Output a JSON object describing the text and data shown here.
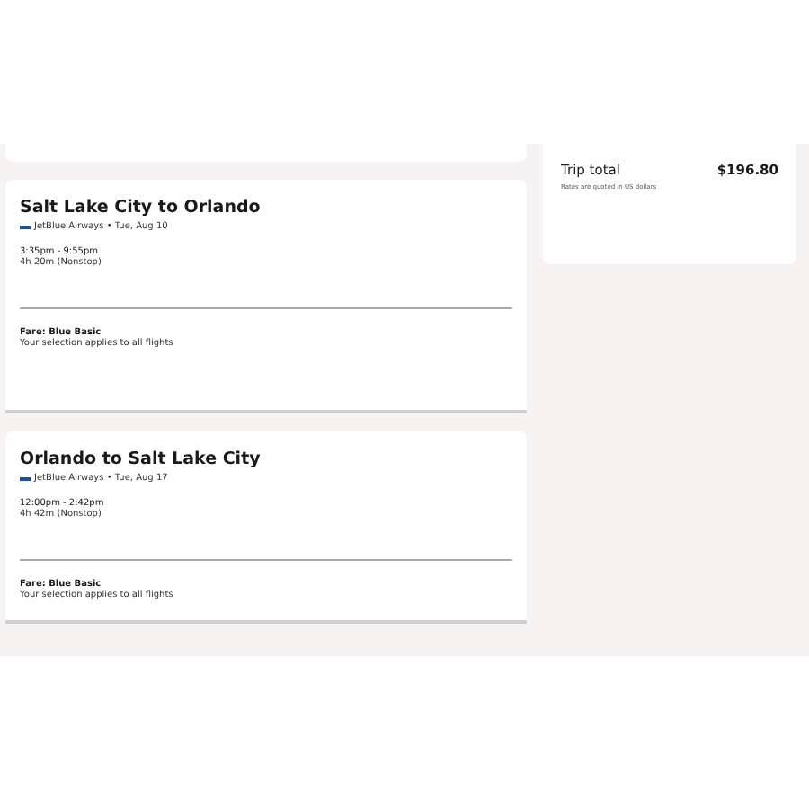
{
  "trip_total": {
    "label": "Trip total",
    "amount": "$196.80",
    "note": "Rates are quoted in US dollars"
  },
  "flights": [
    {
      "title": "Salt Lake City to Orlando",
      "airline_date": "JetBlue Airways • Tue, Aug 10",
      "times": "3:35pm - 9:55pm",
      "duration": "4h 20m (Nonstop)",
      "fare": "Fare: Blue Basic",
      "fare_note": "Your selection applies to all flights"
    },
    {
      "title": "Orlando to Salt Lake City",
      "airline_date": "JetBlue Airways • Tue, Aug 17",
      "times": "12:00pm - 2:42pm",
      "duration": "4h 42m (Nonstop)",
      "fare": "Fare: Blue Basic",
      "fare_note": "Your selection applies to all flights"
    }
  ]
}
